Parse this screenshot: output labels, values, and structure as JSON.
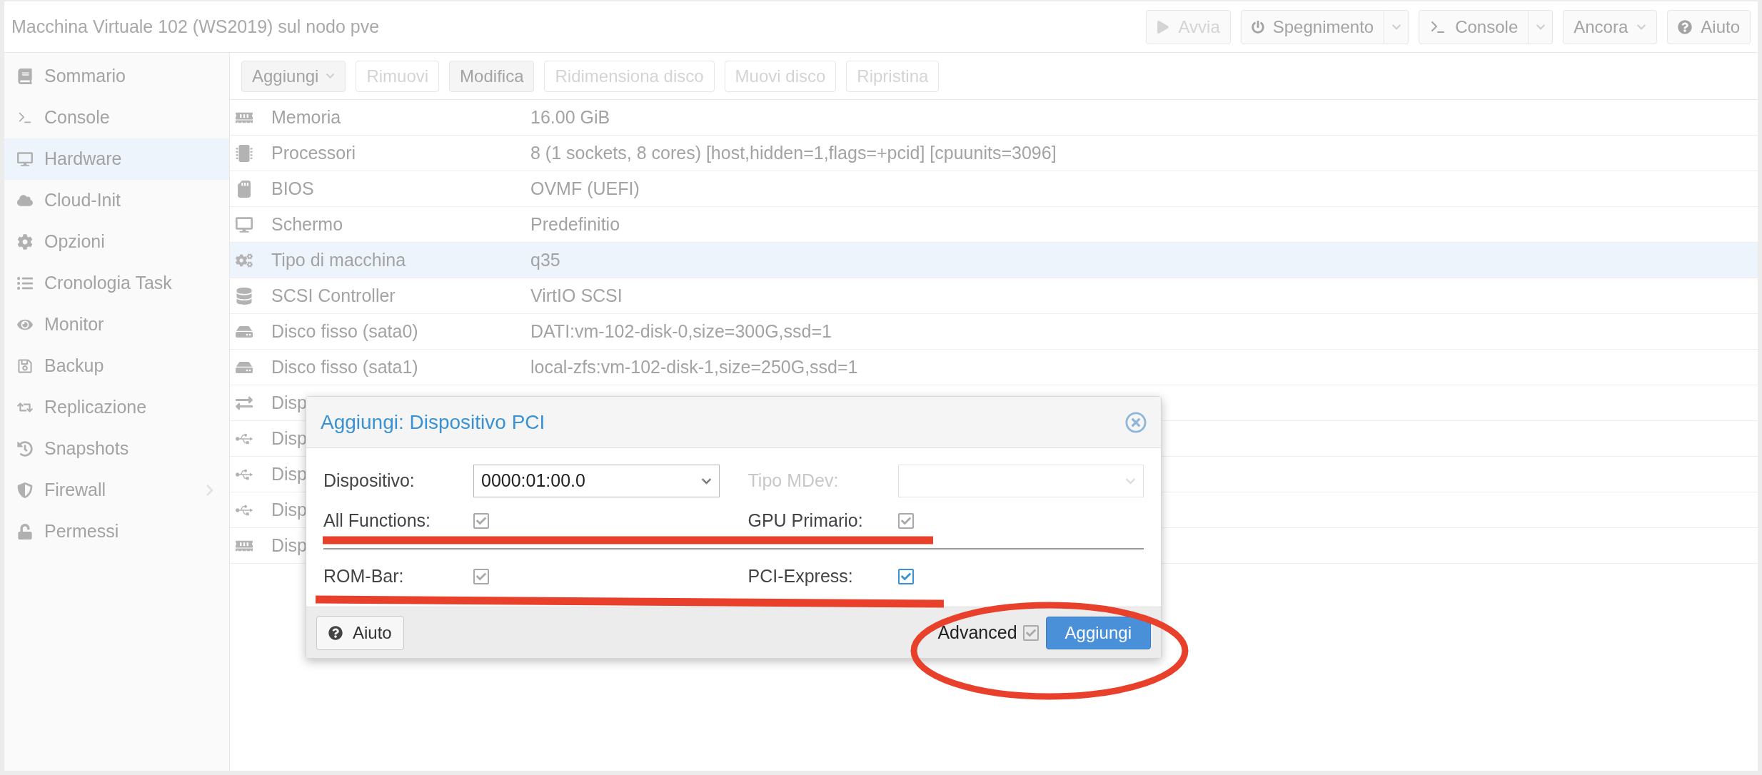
{
  "header": {
    "title": "Macchina Virtuale 102 (WS2019) sul nodo pve",
    "buttons": [
      {
        "label": "Avvia",
        "kind": "start",
        "disabled": true,
        "split": false
      },
      {
        "label": "Spegnimento",
        "kind": "power",
        "disabled": false,
        "split": true
      },
      {
        "label": "Console",
        "kind": "console",
        "disabled": false,
        "split": true
      },
      {
        "label": "Ancora",
        "kind": "menu",
        "disabled": false,
        "split": false
      },
      {
        "label": "Aiuto",
        "kind": "help",
        "disabled": false,
        "split": false
      }
    ]
  },
  "sidebar": {
    "items": [
      {
        "label": "Sommario",
        "selected": false,
        "arrow": false
      },
      {
        "label": "Console",
        "selected": false,
        "arrow": false
      },
      {
        "label": "Hardware",
        "selected": true,
        "arrow": false
      },
      {
        "label": "Cloud-Init",
        "selected": false,
        "arrow": false
      },
      {
        "label": "Opzioni",
        "selected": false,
        "arrow": false
      },
      {
        "label": "Cronologia Task",
        "selected": false,
        "arrow": false
      },
      {
        "label": "Monitor",
        "selected": false,
        "arrow": false
      },
      {
        "label": "Backup",
        "selected": false,
        "arrow": false
      },
      {
        "label": "Replicazione",
        "selected": false,
        "arrow": false
      },
      {
        "label": "Snapshots",
        "selected": false,
        "arrow": false
      },
      {
        "label": "Firewall",
        "selected": false,
        "arrow": true
      },
      {
        "label": "Permessi",
        "selected": false,
        "arrow": false
      }
    ]
  },
  "toolbar": [
    {
      "label": "Aggiungi",
      "disabled": false,
      "dropdown": true
    },
    {
      "label": "Rimuovi",
      "disabled": true,
      "dropdown": false
    },
    {
      "label": "Modifica",
      "disabled": false,
      "dropdown": false
    },
    {
      "label": "Ridimensiona disco",
      "disabled": true,
      "dropdown": false
    },
    {
      "label": "Muovi disco",
      "disabled": true,
      "dropdown": false
    },
    {
      "label": "Ripristina",
      "disabled": true,
      "dropdown": false
    }
  ],
  "hardware": {
    "rows": [
      {
        "name": "Memoria",
        "value": "16.00 GiB",
        "selected": false
      },
      {
        "name": "Processori",
        "value": "8 (1 sockets, 8 cores) [host,hidden=1,flags=+pcid] [cpuunits=3096]",
        "selected": false
      },
      {
        "name": "BIOS",
        "value": "OVMF (UEFI)",
        "selected": false
      },
      {
        "name": "Schermo",
        "value": "Predefinitio",
        "selected": false
      },
      {
        "name": "Tipo di macchina",
        "value": "q35",
        "selected": true
      },
      {
        "name": "SCSI Controller",
        "value": "VirtIO SCSI",
        "selected": false
      },
      {
        "name": "Disco fisso (sata0)",
        "value": "DATI:vm-102-disk-0,size=300G,ssd=1",
        "selected": false
      },
      {
        "name": "Disco fisso (sata1)",
        "value": "local-zfs:vm-102-disk-1,size=250G,ssd=1",
        "selected": false
      },
      {
        "name": "Disp",
        "selected": false
      },
      {
        "name": "Disp",
        "selected": false
      },
      {
        "name": "Disp",
        "selected": false
      },
      {
        "name": "Disp",
        "selected": false
      },
      {
        "name": "Disp",
        "selected": false
      }
    ]
  },
  "dialog": {
    "title": "Aggiungi: Dispositivo PCI",
    "fields": [
      {
        "label": "Dispositivo:",
        "value": "0000:01:00.0",
        "disabled": false
      },
      {
        "label": "Tipo MDev:",
        "disabled": true
      }
    ],
    "checkbox_rows": [
      [
        {
          "label": "All Functions:",
          "checked": true,
          "focused": false
        },
        {
          "label": "GPU Primario:",
          "checked": true,
          "focused": false
        }
      ],
      [
        {
          "label": "ROM-Bar:",
          "checked": true,
          "focused": false
        },
        {
          "label": "PCI-Express:",
          "checked": true,
          "focused": true
        }
      ]
    ],
    "help_button": "Aiuto",
    "advanced": {
      "label": "Advanced",
      "checked": true
    },
    "submit_button": "Aggiungi"
  }
}
